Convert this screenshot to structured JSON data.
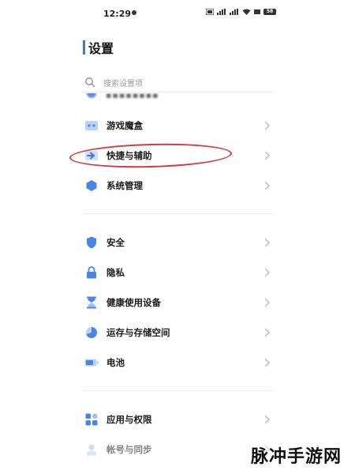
{
  "status_bar": {
    "time": "12:29",
    "battery_level": "58"
  },
  "header": {
    "title": "设置"
  },
  "search": {
    "placeholder": "搜索设置项"
  },
  "settings": {
    "group1": [
      {
        "label": "游戏魔盒",
        "icon": "game-box-icon"
      },
      {
        "label": "快捷与辅助",
        "icon": "shortcut-arrow-icon"
      },
      {
        "label": "系统管理",
        "icon": "system-hexagon-icon"
      }
    ],
    "group2": [
      {
        "label": "安全",
        "icon": "shield-icon"
      },
      {
        "label": "隐私",
        "icon": "lock-icon"
      },
      {
        "label": "健康使用设备",
        "icon": "hourglass-icon"
      },
      {
        "label": "运存与存储空间",
        "icon": "pie-chart-icon"
      },
      {
        "label": "电池",
        "icon": "battery-icon"
      }
    ],
    "group3": [
      {
        "label": "应用与权限",
        "icon": "apps-grid-icon"
      },
      {
        "label": "帐号与同步",
        "icon": "account-person-icon"
      }
    ]
  },
  "colors": {
    "accent": "#3a7bd5",
    "icon_blue": "#4a86e8",
    "highlight_oval": "#d13a3a"
  },
  "watermark": {
    "text": "脉冲手游网"
  }
}
